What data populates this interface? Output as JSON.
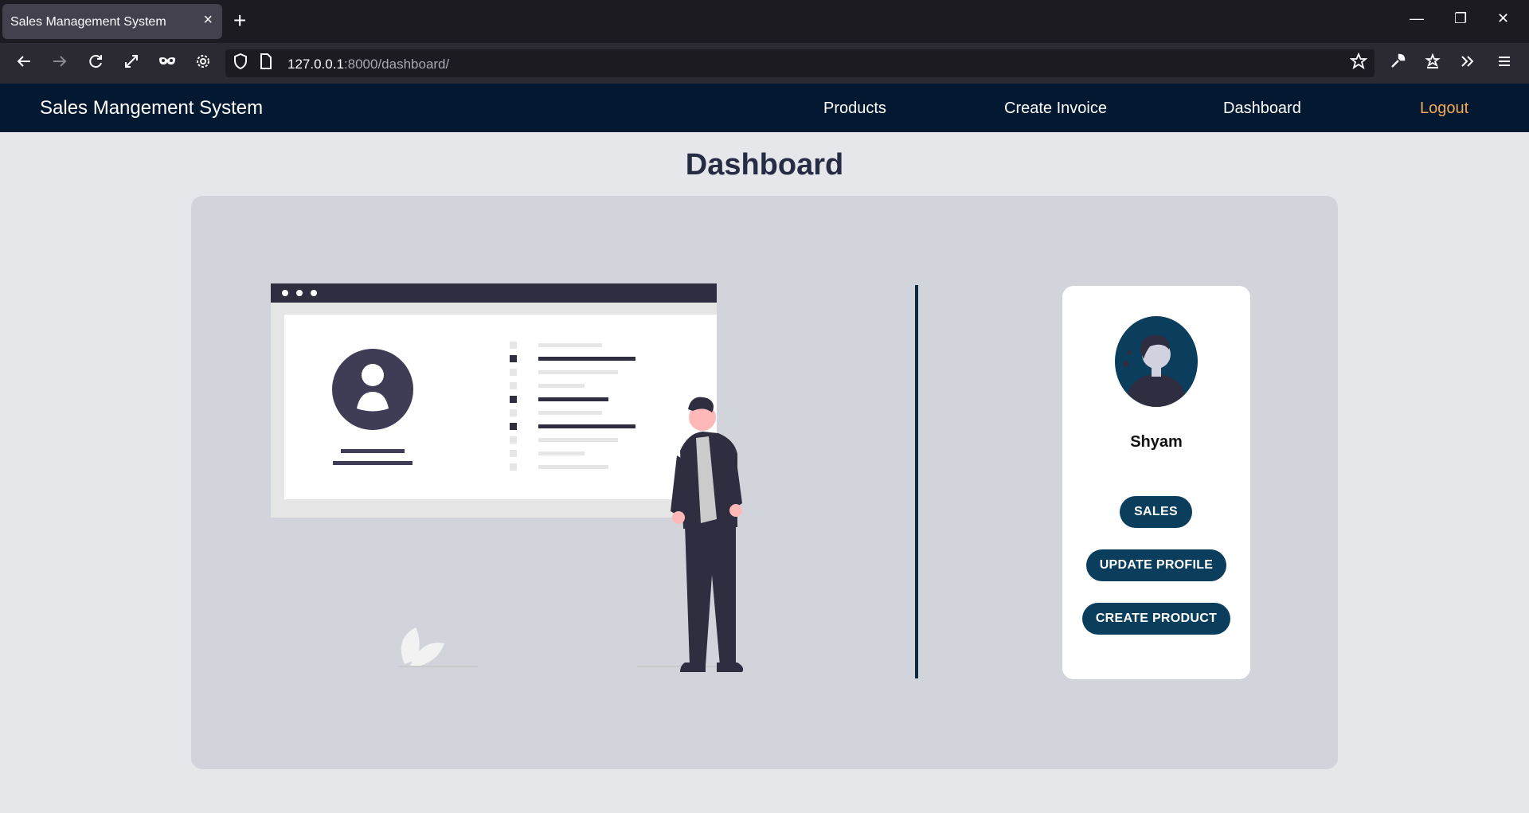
{
  "browser": {
    "tab_title": "Sales Management System",
    "tab_close": "×",
    "new_tab": "+",
    "url_host": "127.0.0.1",
    "url_rest": ":8000/dashboard/",
    "window_controls": {
      "minimize": "—",
      "restore": "❐",
      "close": "✕"
    }
  },
  "header": {
    "brand": "Sales Mangement System",
    "nav": {
      "products": "Products",
      "create_invoice": "Create Invoice",
      "dashboard": "Dashboard",
      "logout": "Logout"
    }
  },
  "main": {
    "title": "Dashboard"
  },
  "profile": {
    "name": "Shyam",
    "buttons": {
      "sales": "SALES",
      "update_profile": "UPDATE PROFILE",
      "create_product": "CREATE PRODUCT"
    }
  },
  "colors": {
    "header_bg": "#031931",
    "logout": "#f5a957",
    "button_bg": "#0b3d5c",
    "title": "#252c44"
  },
  "icons": [
    "back-arrow-icon",
    "forward-arrow-icon",
    "reload-icon",
    "fullscreen-icon",
    "private-mask-icon",
    "settings-gear-icon",
    "shield-icon",
    "page-icon",
    "bookmark-star-icon",
    "wrench-icon",
    "extension-star-icon",
    "overflow-chevrons-icon",
    "hamburger-menu-icon"
  ]
}
